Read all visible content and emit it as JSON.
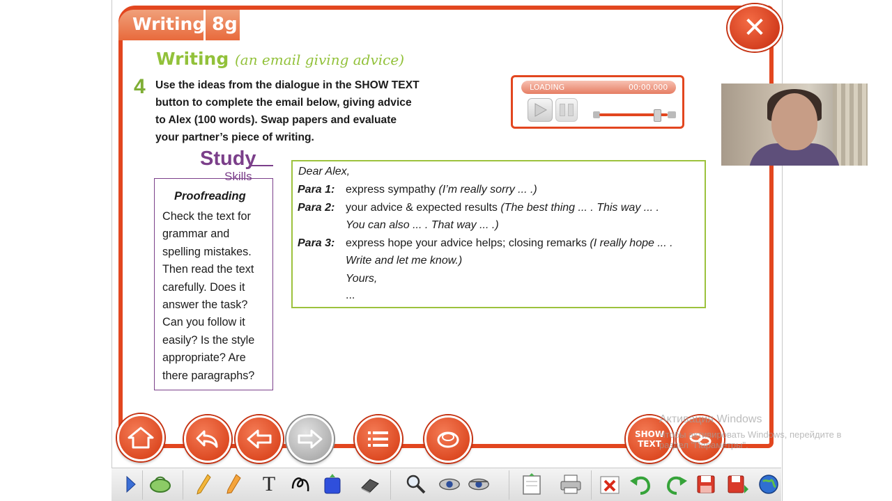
{
  "header": {
    "tab_title": "Writing",
    "tab_number": "8g",
    "close_label": "✕"
  },
  "section": {
    "heading": "Writing",
    "subheading": "(an email giving advice)"
  },
  "task": {
    "number": "4",
    "lines": [
      "Use the ideas from the dialogue in the SHOW TEXT",
      "button to complete the email below, giving advice",
      "to Alex (100 words). Swap papers and evaluate",
      "your partner’s piece of writing."
    ]
  },
  "player": {
    "status": "LOADING",
    "time": "00:00.000",
    "volume_level": 0.85
  },
  "study_skills": {
    "title": "Study",
    "subtitle": "Skills",
    "heading": "Proofreading",
    "lines": [
      "Check the text for",
      "grammar and",
      "spelling mistakes.",
      "Then read the text",
      "carefully. Does it",
      "answer the task?",
      "Can you follow it",
      "easily? Is the style",
      "appropriate? Are",
      "there paragraphs?"
    ]
  },
  "email": {
    "greeting": "Dear Alex,",
    "para1_label": "Para 1:",
    "para1_text": "express sympathy ",
    "para1_example": "(I’m really sorry ... .)",
    "para2_label": "Para 2:",
    "para2_text": "your advice & expected results ",
    "para2_example": "(The best thing ... . This way ... .",
    "para2_example_cont": "You can also ... . That way ... .)",
    "para3_label": "Para 3:",
    "para3_text": "express hope your advice helps; closing remarks ",
    "para3_example": "(I really hope ... .",
    "para3_example_cont": "Write and let me know.)",
    "signoff": "Yours,",
    "signature": "..."
  },
  "nav": {
    "show_text_label_1": "SHOW",
    "show_text_label_2": "TEXT"
  },
  "watermark": {
    "line1": "Активация Windows",
    "line2": "Чтобы активировать Windows, перейдите в",
    "line3": "раздел \"Параметры\"."
  },
  "toolbar": {
    "text_tool": "T"
  },
  "colors": {
    "accent": "#e2461f",
    "green": "#92c13a",
    "purple": "#7b3f8a"
  }
}
